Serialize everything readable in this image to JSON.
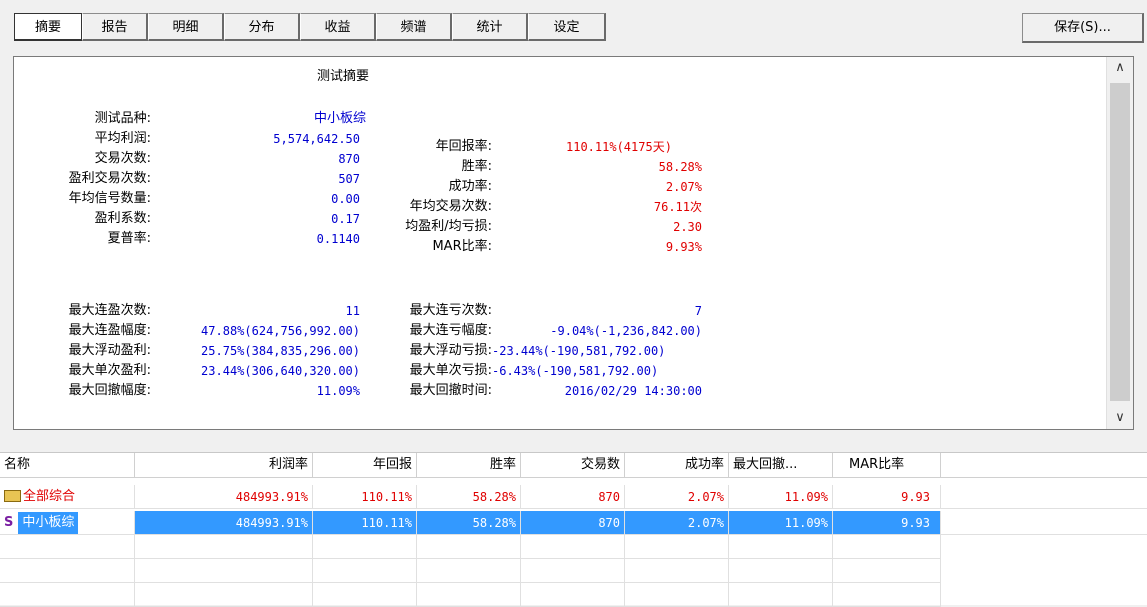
{
  "tabs": [
    "摘要",
    "报告",
    "明细",
    "分布",
    "收益",
    "频谱",
    "统计",
    "设定"
  ],
  "save_button": "保存(S)...",
  "summary": {
    "title": "测试摘要",
    "instrument_label": "测试品种:",
    "instrument_value": "中小板综",
    "rows_left": [
      {
        "label": "平均利润:",
        "value": "5,574,642.50"
      },
      {
        "label": "交易次数:",
        "value": "870"
      },
      {
        "label": "盈利交易次数:",
        "value": "507"
      },
      {
        "label": "年均信号数量:",
        "value": "0.00"
      },
      {
        "label": "盈利系数:",
        "value": "0.17"
      },
      {
        "label": "夏普率:",
        "value": "0.1140"
      }
    ],
    "rows_right": [
      {
        "label": "年回报率:",
        "value": "110.11%(4175天)"
      },
      {
        "label": "胜率:",
        "value": "58.28%"
      },
      {
        "label": "成功率:",
        "value": "2.07%"
      },
      {
        "label": "年均交易次数:",
        "value": "76.11次"
      },
      {
        "label": "均盈利/均亏损:",
        "value": "2.30"
      },
      {
        "label": "MAR比率:",
        "value": "9.93%"
      }
    ],
    "rows2_left": [
      {
        "label": "最大连盈次数:",
        "value": "11"
      },
      {
        "label": "最大连盈幅度:",
        "value": "47.88%(624,756,992.00)"
      },
      {
        "label": "最大浮动盈利:",
        "value": "25.75%(384,835,296.00)"
      },
      {
        "label": "最大单次盈利:",
        "value": "23.44%(306,640,320.00)"
      },
      {
        "label": "最大回撤幅度:",
        "value": "11.09%"
      }
    ],
    "rows2_right": [
      {
        "label": "最大连亏次数:",
        "value": "7"
      },
      {
        "label": "最大连亏幅度:",
        "value": "-9.04%(-1,236,842.00)"
      },
      {
        "label": "最大浮动亏损:",
        "value": "-23.44%(-190,581,792.00)"
      },
      {
        "label": "最大单次亏损:",
        "value": "-6.43%(-190,581,792.00)"
      },
      {
        "label": "最大回撤时间:",
        "value": "2016/02/29 14:30:00"
      }
    ]
  },
  "grid": {
    "headers": [
      "名称",
      "利润率",
      "年回报",
      "胜率",
      "交易数",
      "成功率",
      "最大回撤...",
      "MAR比率"
    ],
    "rows": [
      [
        "全部综合",
        "484993.91%",
        "110.11%",
        "58.28%",
        "870",
        "2.07%",
        "11.09%",
        "9.93"
      ],
      [
        "中小板综",
        "484993.91%",
        "110.11%",
        "58.28%",
        "870",
        "2.07%",
        "11.09%",
        "9.93"
      ]
    ],
    "row_icon_prefix": "S"
  }
}
